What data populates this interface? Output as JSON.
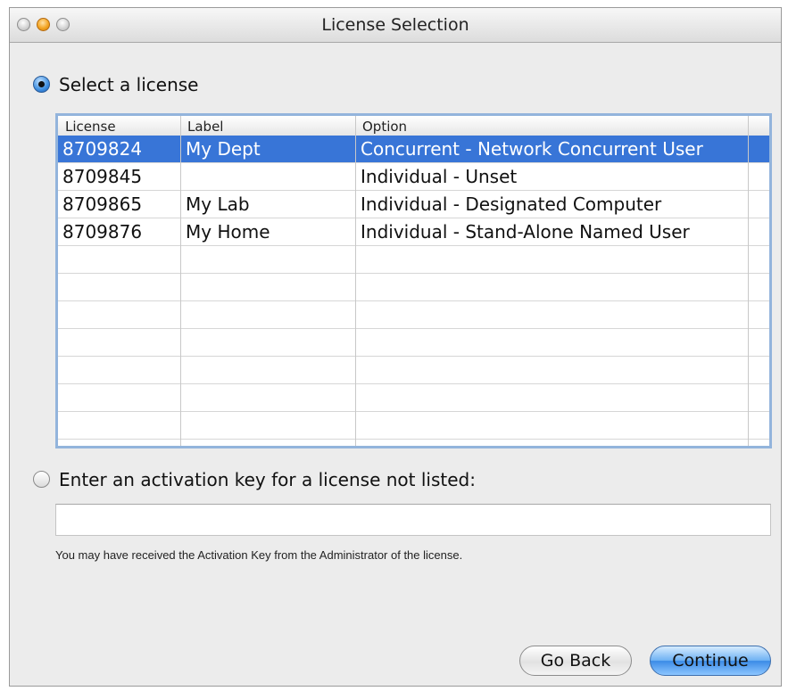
{
  "window": {
    "title": "License Selection"
  },
  "select_option": {
    "label": "Select a license",
    "selected": true
  },
  "table": {
    "columns": [
      "License",
      "Label",
      "Option"
    ],
    "rows": [
      {
        "license": "8709824",
        "label": "My Dept",
        "option": "Concurrent - Network Concurrent User",
        "selected": true
      },
      {
        "license": "8709845",
        "label": "",
        "option": "Individual - Unset",
        "selected": false
      },
      {
        "license": "8709865",
        "label": "My Lab",
        "option": "Individual - Designated Computer",
        "selected": false
      },
      {
        "license": "8709876",
        "label": "My Home",
        "option": "Individual - Stand-Alone Named User",
        "selected": false
      }
    ]
  },
  "activation_option": {
    "label": "Enter an activation key for a license not listed:",
    "selected": false,
    "key_value": ""
  },
  "note": "You may have received the Activation Key from the Administrator of the license.",
  "buttons": {
    "back": "Go Back",
    "continue": "Continue"
  },
  "colors": {
    "selection": "#3875d7",
    "table_focus_ring": "#93b4dc"
  }
}
